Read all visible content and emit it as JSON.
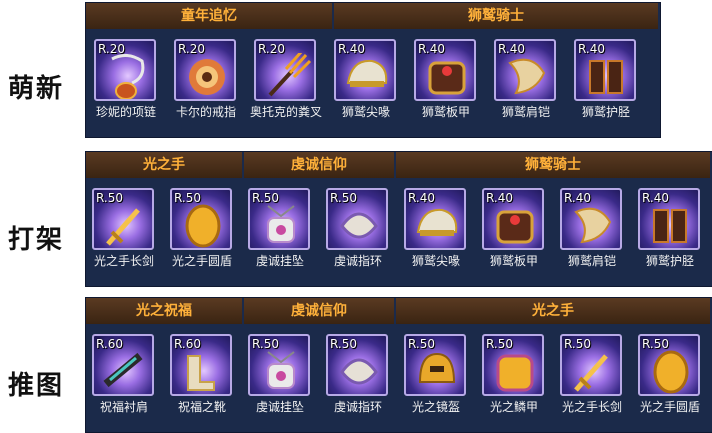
{
  "rows": [
    {
      "label": "萌新",
      "groups": [
        "童年追忆",
        "狮鹫骑士"
      ],
      "items": [
        {
          "rarity": "R.20",
          "name": "珍妮的项链",
          "icon": "necklace-icon"
        },
        {
          "rarity": "R.20",
          "name": "卡尔的戒指",
          "icon": "flower-ring-icon"
        },
        {
          "rarity": "R.20",
          "name": "奥托克的粪叉",
          "icon": "pitchfork-icon"
        },
        {
          "rarity": "R.40",
          "name": "狮鹫尖喙",
          "icon": "helmet-icon"
        },
        {
          "rarity": "R.40",
          "name": "狮鹫板甲",
          "icon": "armor-icon"
        },
        {
          "rarity": "R.40",
          "name": "狮鹫肩铠",
          "icon": "pauldron-icon"
        },
        {
          "rarity": "R.40",
          "name": "狮鹫护胫",
          "icon": "greaves-icon"
        }
      ]
    },
    {
      "label": "打架",
      "groups": [
        "光之手",
        "虔诚信仰",
        "狮鹫骑士"
      ],
      "items": [
        {
          "rarity": "R.50",
          "name": "光之手长剑",
          "icon": "sword-icon"
        },
        {
          "rarity": "R.50",
          "name": "光之手圆盾",
          "icon": "shield-icon"
        },
        {
          "rarity": "R.50",
          "name": "虔诚挂坠",
          "icon": "pendant-icon"
        },
        {
          "rarity": "R.50",
          "name": "虔诚指环",
          "icon": "ring-icon"
        },
        {
          "rarity": "R.40",
          "name": "狮鹫尖喙",
          "icon": "helmet-icon"
        },
        {
          "rarity": "R.40",
          "name": "狮鹫板甲",
          "icon": "armor-icon"
        },
        {
          "rarity": "R.40",
          "name": "狮鹫肩铠",
          "icon": "pauldron-icon"
        },
        {
          "rarity": "R.40",
          "name": "狮鹫护胫",
          "icon": "greaves-icon"
        }
      ]
    },
    {
      "label": "推图",
      "groups": [
        "光之祝福",
        "虔诚信仰",
        "光之手"
      ],
      "items": [
        {
          "rarity": "R.60",
          "name": "祝福衬肩",
          "icon": "blessed-pauldron-icon"
        },
        {
          "rarity": "R.60",
          "name": "祝福之靴",
          "icon": "boots-icon"
        },
        {
          "rarity": "R.50",
          "name": "虔诚挂坠",
          "icon": "pendant-icon"
        },
        {
          "rarity": "R.50",
          "name": "虔诚指环",
          "icon": "ring-icon"
        },
        {
          "rarity": "R.50",
          "name": "光之镜盔",
          "icon": "gold-helmet-icon"
        },
        {
          "rarity": "R.50",
          "name": "光之鳞甲",
          "icon": "gold-armor-icon"
        },
        {
          "rarity": "R.50",
          "name": "光之手长剑",
          "icon": "sword-icon"
        },
        {
          "rarity": "R.50",
          "name": "光之手圆盾",
          "icon": "shield-icon"
        }
      ]
    }
  ],
  "colors": {
    "header_text": "#ffb13a",
    "panel_bg": "#1b2a4a",
    "name_text": "#f2f2f2"
  }
}
